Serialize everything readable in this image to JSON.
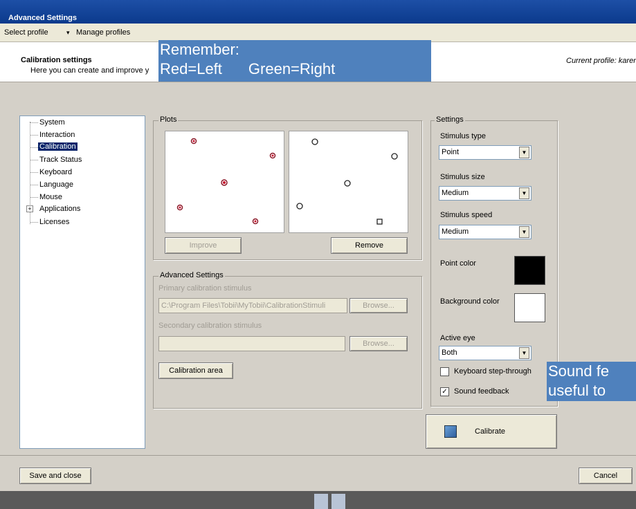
{
  "window": {
    "title": "Advanced Settings"
  },
  "menu": {
    "select_profile": "Select profile",
    "separator": "▾",
    "manage_profiles": "Manage profiles"
  },
  "header": {
    "title": "Calibration settings",
    "subtitle": "Here you can create and improve y",
    "current_profile": "Current profile: karen"
  },
  "callouts": {
    "remember_line1": "Remember:",
    "remember_line2_red": "Red=Left",
    "remember_line2_green": "Green=Right",
    "sound_line1": "Sound fe",
    "sound_line2": "useful to"
  },
  "tree": {
    "items": [
      "System",
      "Interaction",
      "Calibration",
      "Track Status",
      "Keyboard",
      "Language",
      "Mouse",
      "Applications",
      "Licenses"
    ],
    "selected": "Calibration"
  },
  "plots": {
    "label": "Plots",
    "improve_label": "Improve",
    "remove_label": "Remove"
  },
  "advanced": {
    "label": "Advanced Settings",
    "primary_label": "Primary calibration stimulus",
    "primary_value": "C:\\Program Files\\Tobii\\MyTobii\\CalibrationStimuli",
    "secondary_label": "Secondary calibration stimulus",
    "secondary_value": "",
    "browse_label": "Browse...",
    "calibration_area_label": "Calibration area"
  },
  "settings": {
    "label": "Settings",
    "stimulus_type_label": "Stimulus type",
    "stimulus_type_value": "Point",
    "stimulus_size_label": "Stimulus size",
    "stimulus_size_value": "Medium",
    "stimulus_speed_label": "Stimulus speed",
    "stimulus_speed_value": "Medium",
    "point_color_label": "Point color",
    "point_color": "#000000",
    "background_color_label": "Background color",
    "background_color": "#ffffff",
    "active_eye_label": "Active eye",
    "active_eye_value": "Both",
    "keyboard_step_label": "Keyboard step-through",
    "keyboard_step_checked": false,
    "sound_feedback_label": "Sound feedback",
    "sound_feedback_checked": true,
    "calibrate_label": "Calibrate"
  },
  "footer": {
    "save_close_label": "Save and close",
    "cancel_label": "Cancel"
  },
  "colors": {
    "titlebar": "#0b3a8c",
    "callout": "#4f81bd",
    "selected": "#0a246a"
  }
}
